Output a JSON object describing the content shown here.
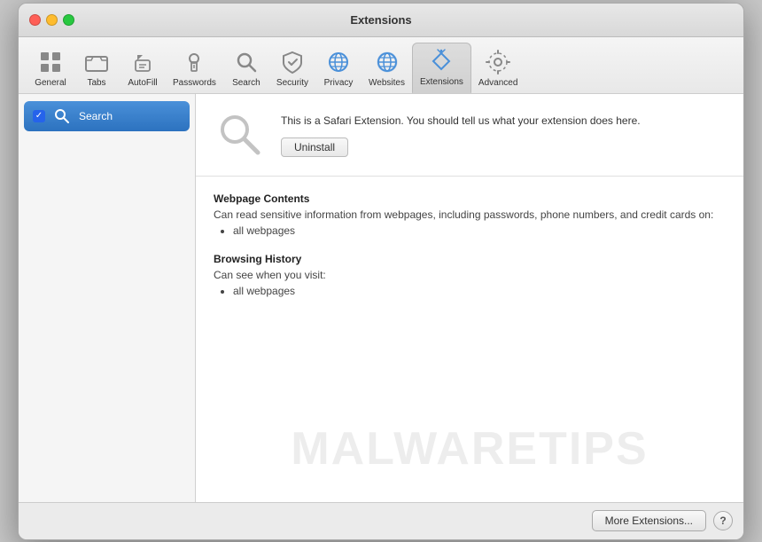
{
  "window": {
    "title": "Extensions"
  },
  "toolbar": {
    "items": [
      {
        "id": "general",
        "label": "General",
        "icon": "general"
      },
      {
        "id": "tabs",
        "label": "Tabs",
        "icon": "tabs"
      },
      {
        "id": "autofill",
        "label": "AutoFill",
        "icon": "autofill"
      },
      {
        "id": "passwords",
        "label": "Passwords",
        "icon": "passwords"
      },
      {
        "id": "search",
        "label": "Search",
        "icon": "search"
      },
      {
        "id": "security",
        "label": "Security",
        "icon": "security"
      },
      {
        "id": "privacy",
        "label": "Privacy",
        "icon": "privacy"
      },
      {
        "id": "websites",
        "label": "Websites",
        "icon": "websites"
      },
      {
        "id": "extensions",
        "label": "Extensions",
        "icon": "extensions",
        "active": true
      },
      {
        "id": "advanced",
        "label": "Advanced",
        "icon": "advanced"
      }
    ]
  },
  "sidebar": {
    "items": [
      {
        "id": "search-ext",
        "label": "Search",
        "checked": true,
        "selected": true
      }
    ]
  },
  "extension": {
    "description": "This is a Safari Extension. You should tell us what your extension does here.",
    "uninstall_label": "Uninstall",
    "permissions": [
      {
        "title": "Webpage Contents",
        "description": "Can read sensitive information from webpages, including passwords, phone numbers, and credit cards on:",
        "items": [
          "all webpages"
        ]
      },
      {
        "title": "Browsing History",
        "description": "Can see when you visit:",
        "items": [
          "all webpages"
        ]
      }
    ]
  },
  "footer": {
    "more_extensions_label": "More Extensions...",
    "help_label": "?"
  },
  "watermark": {
    "text": "MALWARETIPS"
  }
}
